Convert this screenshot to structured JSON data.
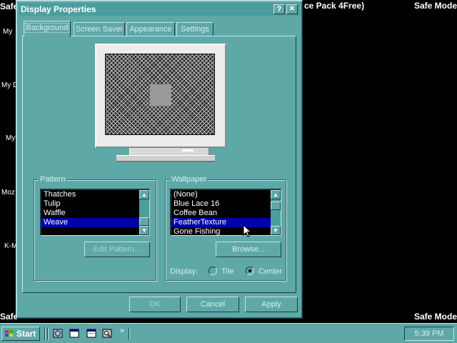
{
  "desktop": {
    "corner_text_top_left": "Safe",
    "corner_text_top_right": "Safe Mode",
    "corner_text_bottom_left": "Safe",
    "corner_text_bottom_right": "Safe Mode",
    "banner_fragment": "ce Pack 4Free)",
    "icon_labels": [
      "My",
      "My D",
      "My",
      "Moz",
      "K-M"
    ]
  },
  "window": {
    "title": "Display Properties",
    "help_button": "?",
    "close_button": "✕",
    "tabs": [
      {
        "label": "Background",
        "active": true
      },
      {
        "label": "Screen Saver",
        "active": false
      },
      {
        "label": "Appearance",
        "active": false
      },
      {
        "label": "Settings",
        "active": false
      }
    ],
    "pattern": {
      "group_label": "Pattern",
      "items": [
        "Thatches",
        "Tulip",
        "Waffle",
        "Weave"
      ],
      "selected": "Weave",
      "edit_button": "Edit Pattern..."
    },
    "wallpaper": {
      "group_label": "Wallpaper",
      "items": [
        "(None)",
        "Blue Lace 16",
        "Coffee Bean",
        "FeatherTexture",
        "Gone Fishing"
      ],
      "selected": "FeatherTexture",
      "browse_button": "Browse...",
      "display_label": "Display:",
      "options": [
        "Tile",
        "Center"
      ],
      "selected_option": "Center"
    },
    "buttons": {
      "ok": "OK",
      "cancel": "Cancel",
      "apply": "Apply"
    }
  },
  "taskbar": {
    "start_label": "Start",
    "quick_launch": [
      "internet-explorer-icon",
      "desktop-icon",
      "window-icon",
      "find-icon"
    ],
    "chevron": "»",
    "clock": "5:39 PM"
  },
  "colors": {
    "theme": "#5fa8a8",
    "selection": "#0000a8",
    "desktop": "#000000"
  }
}
